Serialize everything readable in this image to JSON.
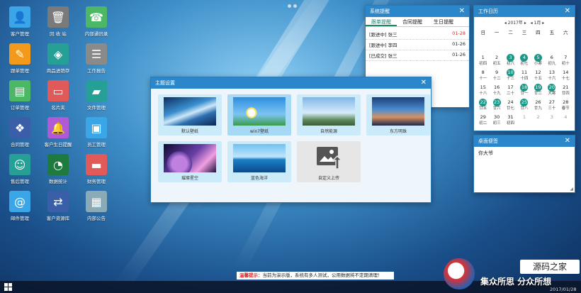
{
  "desktop": {
    "icons": [
      {
        "label": "客户管理",
        "icon": "user-icon",
        "color": "#3aa6e8",
        "glyph": "👤"
      },
      {
        "label": "回 收 站",
        "icon": "trash-icon",
        "color": "#7a7a7a",
        "glyph": "🗑"
      },
      {
        "label": "内部通讯录",
        "icon": "contacts-icon",
        "color": "#4cb866",
        "glyph": "☎"
      },
      {
        "label": "跟单管理",
        "icon": "edit-icon",
        "color": "#f39a1c",
        "glyph": "✎"
      },
      {
        "label": "商品进销存",
        "icon": "box-icon",
        "color": "#26a096",
        "glyph": "◈"
      },
      {
        "label": "工作报告",
        "icon": "report-icon",
        "color": "#8a8a8a",
        "glyph": "☰"
      },
      {
        "label": "订单管理",
        "icon": "order-icon",
        "color": "#4cb866",
        "glyph": "▤"
      },
      {
        "label": "名片夹",
        "icon": "card-icon",
        "color": "#e05a5a",
        "glyph": "▭"
      },
      {
        "label": "文件管理",
        "icon": "folder-icon",
        "color": "#26a096",
        "glyph": "▰"
      },
      {
        "label": "合同管理",
        "icon": "contract-icon",
        "color": "#3a5fa8",
        "glyph": "❖"
      },
      {
        "label": "客户生日提醒",
        "icon": "bell-icon",
        "color": "#b15ad6",
        "glyph": "🔔"
      },
      {
        "label": "员工管理",
        "icon": "staff-icon",
        "color": "#3aa6e8",
        "glyph": "▣"
      },
      {
        "label": "售后管理",
        "icon": "service-icon",
        "color": "#26a096",
        "glyph": "☺"
      },
      {
        "label": "数据统计",
        "icon": "chart-icon",
        "color": "#1e7a3e",
        "glyph": "◔"
      },
      {
        "label": "财务管理",
        "icon": "wallet-icon",
        "color": "#e05a5a",
        "glyph": "▬"
      },
      {
        "label": "邮件管理",
        "icon": "mail-icon",
        "color": "#3aa6e8",
        "glyph": "@"
      },
      {
        "label": "客户资源库",
        "icon": "resource-icon",
        "color": "#3a5fa8",
        "glyph": "⇄"
      },
      {
        "label": "内部公告",
        "icon": "notice-icon",
        "color": "#8aaab8",
        "glyph": "▦"
      }
    ]
  },
  "reminder": {
    "title": "系统提醒",
    "tabs": [
      "跟单提醒",
      "合同提醒",
      "生日提醒"
    ],
    "rows": [
      {
        "text": "[跟进中] 张三",
        "date": "01-28",
        "red": true
      },
      {
        "text": "[跟进中] 李四",
        "date": "01-26",
        "red": false
      },
      {
        "text": "[已成交] 张三",
        "date": "01-26",
        "red": false
      }
    ]
  },
  "calendar": {
    "title": "工作日历",
    "year": "2017年",
    "month": "1月",
    "weekdays": [
      "日",
      "一",
      "二",
      "三",
      "四",
      "五",
      "六"
    ],
    "cells": [
      {
        "n": "",
        "l": ""
      },
      {
        "n": "",
        "l": ""
      },
      {
        "n": "",
        "l": ""
      },
      {
        "n": "",
        "l": ""
      },
      {
        "n": "",
        "l": ""
      },
      {
        "n": "",
        "l": ""
      },
      {
        "n": "",
        "l": ""
      },
      {
        "n": "1",
        "l": "初四"
      },
      {
        "n": "2",
        "l": "初五"
      },
      {
        "n": "3",
        "l": "初六",
        "hl": true
      },
      {
        "n": "4",
        "l": "初七",
        "hl": true
      },
      {
        "n": "5",
        "l": "小寒",
        "hl": true
      },
      {
        "n": "6",
        "l": "初九"
      },
      {
        "n": "7",
        "l": "初十"
      },
      {
        "n": "8",
        "l": "十一"
      },
      {
        "n": "9",
        "l": "十二"
      },
      {
        "n": "10",
        "l": "十三",
        "hl": true
      },
      {
        "n": "11",
        "l": "十四"
      },
      {
        "n": "12",
        "l": "十五"
      },
      {
        "n": "13",
        "l": "十六"
      },
      {
        "n": "14",
        "l": "十七"
      },
      {
        "n": "15",
        "l": "十八"
      },
      {
        "n": "16",
        "l": "十九"
      },
      {
        "n": "17",
        "l": "二十"
      },
      {
        "n": "18",
        "l": "廿一",
        "hl": true
      },
      {
        "n": "19",
        "l": "廿二",
        "hl": true
      },
      {
        "n": "20",
        "l": "大寒",
        "hl": true
      },
      {
        "n": "21",
        "l": "廿四"
      },
      {
        "n": "22",
        "l": "廿五",
        "hl": true
      },
      {
        "n": "23",
        "l": "廿六",
        "hl": true
      },
      {
        "n": "24",
        "l": "廿七"
      },
      {
        "n": "25",
        "l": "廿八",
        "hl": true
      },
      {
        "n": "26",
        "l": "廿九"
      },
      {
        "n": "27",
        "l": "三十"
      },
      {
        "n": "28",
        "l": "春节"
      },
      {
        "n": "29",
        "l": "初二"
      },
      {
        "n": "30",
        "l": "初三"
      },
      {
        "n": "31",
        "l": "初四"
      },
      {
        "n": "1",
        "l": "",
        "dim": true
      },
      {
        "n": "2",
        "l": "",
        "dim": true
      },
      {
        "n": "3",
        "l": "",
        "dim": true
      },
      {
        "n": "4",
        "l": "",
        "dim": true
      }
    ]
  },
  "notes": {
    "title": "桌面便签",
    "text": "你大爷"
  },
  "theme": {
    "title": "主题设置",
    "items": [
      {
        "caption": "默认壁纸",
        "selected": false
      },
      {
        "caption": "win7壁纸",
        "selected": true
      },
      {
        "caption": "自然能源",
        "selected": false
      },
      {
        "caption": "东方明珠",
        "selected": false
      },
      {
        "caption": "璀璨星空",
        "selected": false
      },
      {
        "caption": "蓝色海洋",
        "selected": false
      },
      {
        "caption": "自定义上传",
        "selected": false
      }
    ]
  },
  "notice_bar": {
    "label": "温馨提示：",
    "text": "当前为演示版，系统有多人测试，公用数据将不定期清理！"
  },
  "watermark": {
    "brand": "源码之家",
    "slogan": "集众所思 分众所想",
    "date": "2017/01/28"
  }
}
